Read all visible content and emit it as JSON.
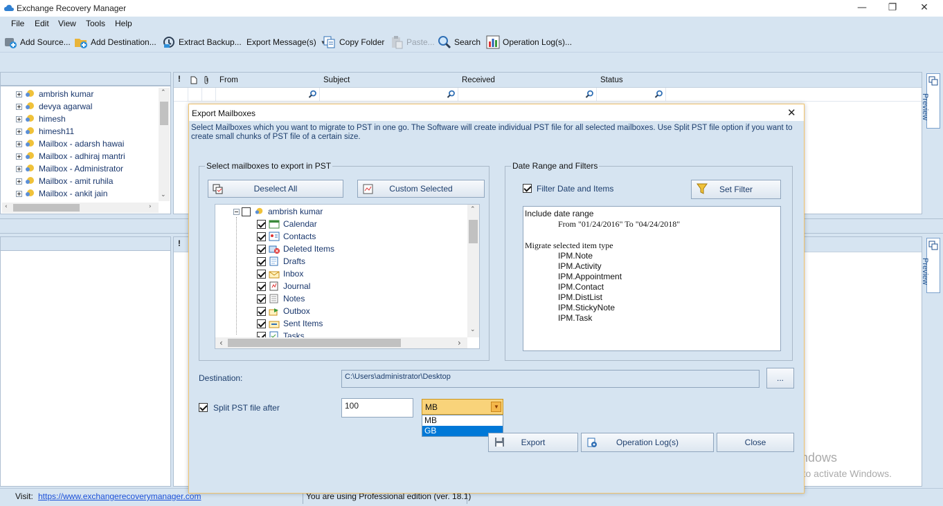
{
  "window": {
    "title": "Exchange Recovery Manager",
    "minimize": "—",
    "maximize": "❐",
    "close": "✕"
  },
  "menu": [
    "File",
    "Edit",
    "View",
    "Tools",
    "Help"
  ],
  "toolbar": {
    "add_source": "Add Source...",
    "add_destination": "Add Destination...",
    "extract_backup": "Extract Backup...",
    "export_messages": "Export Message(s)",
    "copy_folder": "Copy Folder",
    "paste": "Paste...",
    "search": "Search",
    "operation_logs": "Operation Log(s)..."
  },
  "left_tree": {
    "items": [
      "ambrish kumar",
      "devya agarwal",
      "himesh",
      "himesh11",
      "Mailbox - adarsh hawai",
      "Mailbox - adhiraj mantri",
      "Mailbox - Administrator",
      "Mailbox - amit ruhila",
      "Mailbox - ankit jain"
    ]
  },
  "grid": {
    "columns": [
      "!",
      "From",
      "Subject",
      "Received",
      "Status"
    ]
  },
  "lower_grid": {
    "first_col": "!"
  },
  "preview": {
    "label": "Preview"
  },
  "dialog": {
    "title": "Export Mailboxes",
    "close": "✕",
    "description": "Select Mailboxes which you want to migrate to PST in one go. The Software will create individual PST file for all selected mailboxes. Use Split PST file option if you want to create small chunks of PST file of a certain size.",
    "mailbox_group": {
      "title": "Select mailboxes to export in PST",
      "deselect_all": "Deselect All",
      "custom_selected": "Custom Selected",
      "root": "ambrish kumar",
      "folders": [
        "Calendar",
        "Contacts",
        "Deleted Items",
        "Drafts",
        "Inbox",
        "Journal",
        "Notes",
        "Outbox",
        "Sent Items",
        "Tasks"
      ]
    },
    "date_group": {
      "title": "Date Range and Filters",
      "filter_label": "Filter Date and Items",
      "set_filter": "Set Filter",
      "line1": "Include date range",
      "line2": "From \"01/24/2016\" To \"04/24/2018\"",
      "line3": "Migrate selected item type",
      "types": [
        "IPM.Note",
        "IPM.Activity",
        "IPM.Appointment",
        "IPM.Contact",
        "IPM.DistList",
        "IPM.StickyNote",
        "IPM.Task"
      ]
    },
    "destination_label": "Destination:",
    "destination_value": "C:\\Users\\administrator\\Desktop",
    "browse": "...",
    "split_label": "Split PST file after",
    "split_value": "100",
    "unit_selected": "MB",
    "unit_options": [
      "MB",
      "GB"
    ],
    "export": "Export",
    "operation_logs": "Operation Log(s)",
    "close_button": "Close"
  },
  "status": {
    "visit_label": "Visit:",
    "visit_link": "https://www.exchangerecoverymanager.com",
    "edition": "You are using Professional edition (ver. 18.1)"
  },
  "watermark": {
    "line1": "Activate Windows",
    "line2": "Go to Settings to activate Windows."
  }
}
